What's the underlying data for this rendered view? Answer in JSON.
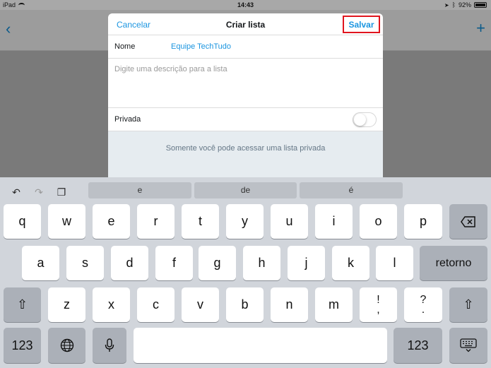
{
  "status_bar": {
    "device": "iPad",
    "time": "14:43",
    "battery": "92%"
  },
  "background_app": {
    "back_glyph": "‹",
    "add_glyph": "+"
  },
  "modal": {
    "cancel_label": "Cancelar",
    "title": "Criar lista",
    "save_label": "Salvar",
    "name_label": "Nome",
    "name_value": "Equipe TechTudo",
    "description_placeholder": "Digite uma descrição para a lista",
    "private_label": "Privada",
    "private_on": false,
    "private_note": "Somente você pode acessar uma lista privada"
  },
  "keyboard": {
    "suggestions": [
      "e",
      "de",
      "é"
    ],
    "row1": [
      "q",
      "w",
      "e",
      "r",
      "t",
      "y",
      "u",
      "i",
      "o",
      "p"
    ],
    "row2": [
      "a",
      "s",
      "d",
      "f",
      "g",
      "h",
      "j",
      "k",
      "l"
    ],
    "return_label": "retorno",
    "row3": [
      "z",
      "x",
      "c",
      "v",
      "b",
      "n",
      "m"
    ],
    "punct1_top": "!",
    "punct1_bottom": ",",
    "punct2_top": "?",
    "punct2_bottom": ".",
    "numbers_label": "123",
    "space_label": ""
  },
  "colors": {
    "accent": "#1b95e0",
    "highlight_border": "#e0151e",
    "keyboard_bg": "#d1d5db"
  }
}
